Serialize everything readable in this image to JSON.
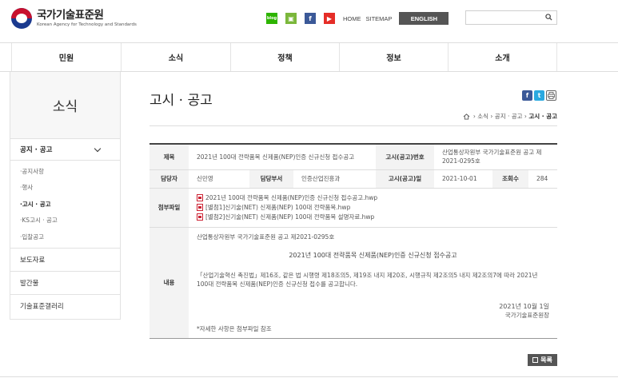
{
  "header": {
    "logo_ko": "국가기술표준원",
    "logo_en": "Korean Agency for Technology and Standards",
    "util_links": {
      "home": "HOME",
      "sitemap": "SITEMAP",
      "english": "ENGLISH"
    },
    "sns": {
      "blog": "blog",
      "app": "▣",
      "facebook": "f",
      "youtube": "▶"
    },
    "search": {
      "value": "",
      "placeholder": ""
    }
  },
  "gnb": [
    "민원",
    "소식",
    "정책",
    "정보",
    "소개"
  ],
  "lnb": {
    "title": "소식",
    "group": "공지 · 공고",
    "sub_items": [
      "공지사항",
      "행사",
      "고시 · 공고",
      "KS고시 · 공고",
      "입찰공고"
    ],
    "active_sub": "고시 · 공고",
    "items": [
      "보도자료",
      "발간물",
      "기술표준갤러리"
    ]
  },
  "content": {
    "page_title": "고시 · 공고",
    "breadcrumb": {
      "path": "› 소식 › 공지 · 공고 ›",
      "current": "고시 · 공고"
    },
    "share": {
      "facebook": "f",
      "twitter": "t",
      "print": "⎙"
    },
    "table": {
      "title_label": "제목",
      "title_value": "2021년 100대 전략품목 신제품(NEP)인증 신규신청 접수공고",
      "notice_no_label": "고시(공고)번호",
      "notice_no_value": "산업통상자원부 국가기술표준원 공고 제2021-0295호",
      "manager_label": "담당자",
      "manager_value": "신민영",
      "dept_label": "담당부서",
      "dept_value": "인증산업진흥과",
      "date_label": "고시(공고)일",
      "date_value": "2021-10-01",
      "views_label": "조회수",
      "views_value": "284",
      "files_label": "첨부파일",
      "files": [
        "2021년 100대 전략품목 신제품(NEP)인증 신규신청 접수공고.hwp",
        "[별첨1]신기술(NET) 신제품(NEP) 100대 전략품목.hwp",
        "[별첨2]신기술(NET) 신제품(NEP) 100대 전략품목 설명자료.hwp"
      ],
      "content_label": "내용",
      "body": {
        "line1": "산업통상자원부 국가기술표준원 공고 제2021-0295호",
        "heading": "2021년 100대 전략품목 신제품(NEP)인증 신규신청 접수공고",
        "para": "「산업기술혁신 촉진법」제16조, 같은 법 시행령 제18조의5, 제19조 내지 제20조, 시행규칙 제2조의5 내지 제2조의7에 따라 2021년 100대 전략품목 신제품(NEP)인증 신규신청 접수를 공고합니다.",
        "date": "2021년 10월 1일",
        "org": "국가기술표준원장",
        "note": "*자세한 사항은 첨부파일 참조"
      }
    },
    "list_button": "목록"
  }
}
